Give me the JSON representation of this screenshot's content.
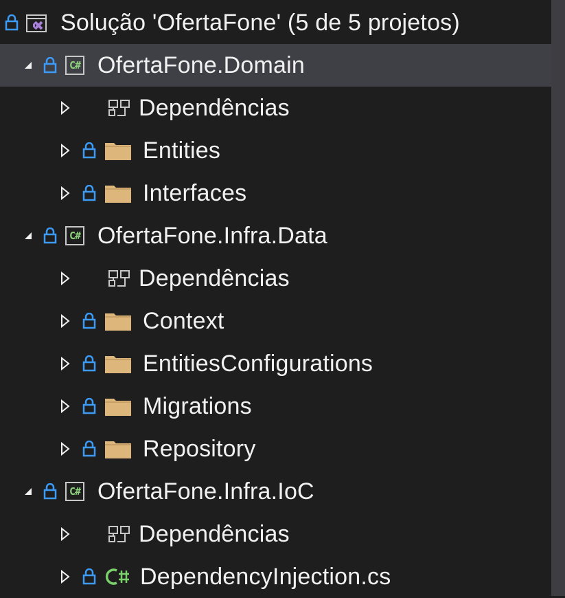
{
  "solution_explorer": {
    "solution_label": "Solução 'OfertaFone' (5 de 5 projetos)",
    "items": [
      {
        "label": "OfertaFone.Domain"
      },
      {
        "label": "Dependências"
      },
      {
        "label": "Entities"
      },
      {
        "label": "Interfaces"
      },
      {
        "label": "OfertaFone.Infra.Data"
      },
      {
        "label": "Dependências"
      },
      {
        "label": "Context"
      },
      {
        "label": "EntitiesConfigurations"
      },
      {
        "label": "Migrations"
      },
      {
        "label": "Repository"
      },
      {
        "label": "OfertaFone.Infra.IoC"
      },
      {
        "label": "Dependências"
      },
      {
        "label": "DependencyInjection.cs"
      }
    ]
  },
  "colors": {
    "background": "#1e1e1e",
    "selected_row": "#3f3f46",
    "lock_blue": "#3c9bf7",
    "folder": "#dcb67a",
    "csharp_green": "#8cd17c"
  }
}
